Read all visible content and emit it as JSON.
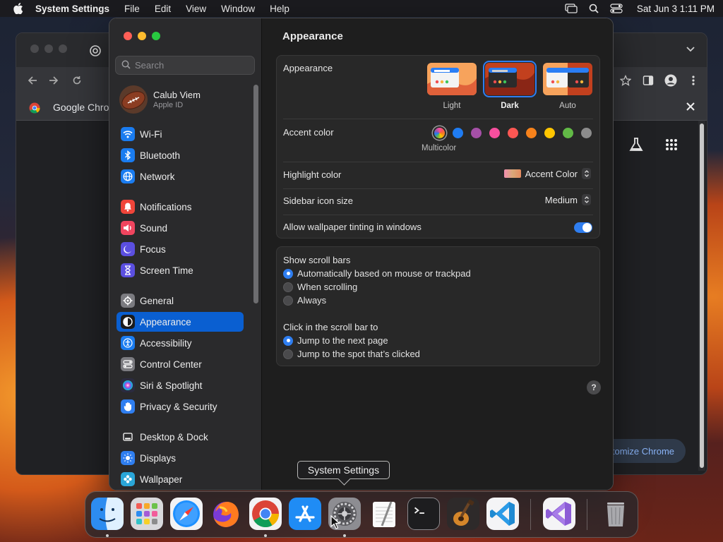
{
  "menubar": {
    "app_name": "System Settings",
    "menus": [
      "File",
      "Edit",
      "View",
      "Window",
      "Help"
    ],
    "clock": "Sat Jun 3  1:11 PM"
  },
  "chrome": {
    "infobar_label": "Google Chrome",
    "customize_label": "tomize Chrome"
  },
  "sidebar": {
    "search_placeholder": "Search",
    "account": {
      "name": "Calub Viem",
      "subtitle": "Apple ID"
    },
    "items": [
      {
        "label": "Wi-Fi",
        "icon": "wifi-icon",
        "color": "#1a7cf0"
      },
      {
        "label": "Bluetooth",
        "icon": "bluetooth-icon",
        "color": "#1a7cf0"
      },
      {
        "label": "Network",
        "icon": "globe-icon",
        "color": "#1a7cf0"
      },
      {
        "label": "Notifications",
        "icon": "bell-icon",
        "color": "#f0453a"
      },
      {
        "label": "Sound",
        "icon": "speaker-icon",
        "color": "#f0455f"
      },
      {
        "label": "Focus",
        "icon": "moon-icon",
        "color": "#5b4fe0"
      },
      {
        "label": "Screen Time",
        "icon": "hourglass-icon",
        "color": "#5b4fe0"
      },
      {
        "label": "General",
        "icon": "gear-icon",
        "color": "#7b7b80"
      },
      {
        "label": "Appearance",
        "icon": "appearance-icon",
        "color": "#1b1b1b",
        "selected": true
      },
      {
        "label": "Accessibility",
        "icon": "accessibility-icon",
        "color": "#1a7cf0"
      },
      {
        "label": "Control Center",
        "icon": "control-center-icon",
        "color": "#7b7b80"
      },
      {
        "label": "Siri & Spotlight",
        "icon": "siri-icon",
        "color": "#2b2b40"
      },
      {
        "label": "Privacy & Security",
        "icon": "hand-icon",
        "color": "#2f7ef0"
      },
      {
        "label": "Desktop & Dock",
        "icon": "dock-icon",
        "color": "#2b2b2d"
      },
      {
        "label": "Displays",
        "icon": "sun-icon",
        "color": "#2f7ef0"
      },
      {
        "label": "Wallpaper",
        "icon": "wallpaper-icon",
        "color": "#2aa6d8"
      }
    ]
  },
  "main": {
    "title": "Appearance",
    "appearance": {
      "label": "Appearance",
      "options": [
        {
          "label": "Light",
          "selected": false
        },
        {
          "label": "Dark",
          "selected": true
        },
        {
          "label": "Auto",
          "selected": false
        }
      ]
    },
    "accent": {
      "label": "Accent color",
      "selected_caption": "Multicolor",
      "colors": [
        "multicolor",
        "#1f7cf2",
        "#a550a7",
        "#f74f9e",
        "#fc5753",
        "#f7821b",
        "#ffc600",
        "#62ba46",
        "#8c8c8c"
      ]
    },
    "highlight": {
      "label": "Highlight color",
      "value": "Accent Color"
    },
    "icon_size": {
      "label": "Sidebar icon size",
      "value": "Medium"
    },
    "tinting": {
      "label": "Allow wallpaper tinting in windows",
      "enabled": true
    },
    "scroll_bars": {
      "label": "Show scroll bars",
      "options": [
        {
          "label": "Automatically based on mouse or trackpad",
          "selected": true
        },
        {
          "label": "When scrolling",
          "selected": false
        },
        {
          "label": "Always",
          "selected": false
        }
      ]
    },
    "click_scroll": {
      "label": "Click in the scroll bar to",
      "options": [
        {
          "label": "Jump to the next page",
          "selected": true
        },
        {
          "label": "Jump to the spot that’s clicked",
          "selected": false
        }
      ]
    },
    "help": "?"
  },
  "dock": {
    "tooltip": "System Settings",
    "apps": [
      "Finder",
      "Launchpad",
      "Safari",
      "Firefox",
      "Google Chrome",
      "App Store",
      "System Settings",
      "TextEdit",
      "Terminal",
      "GarageBand",
      "Visual Studio Code",
      "Visual Studio",
      "Trash"
    ]
  }
}
